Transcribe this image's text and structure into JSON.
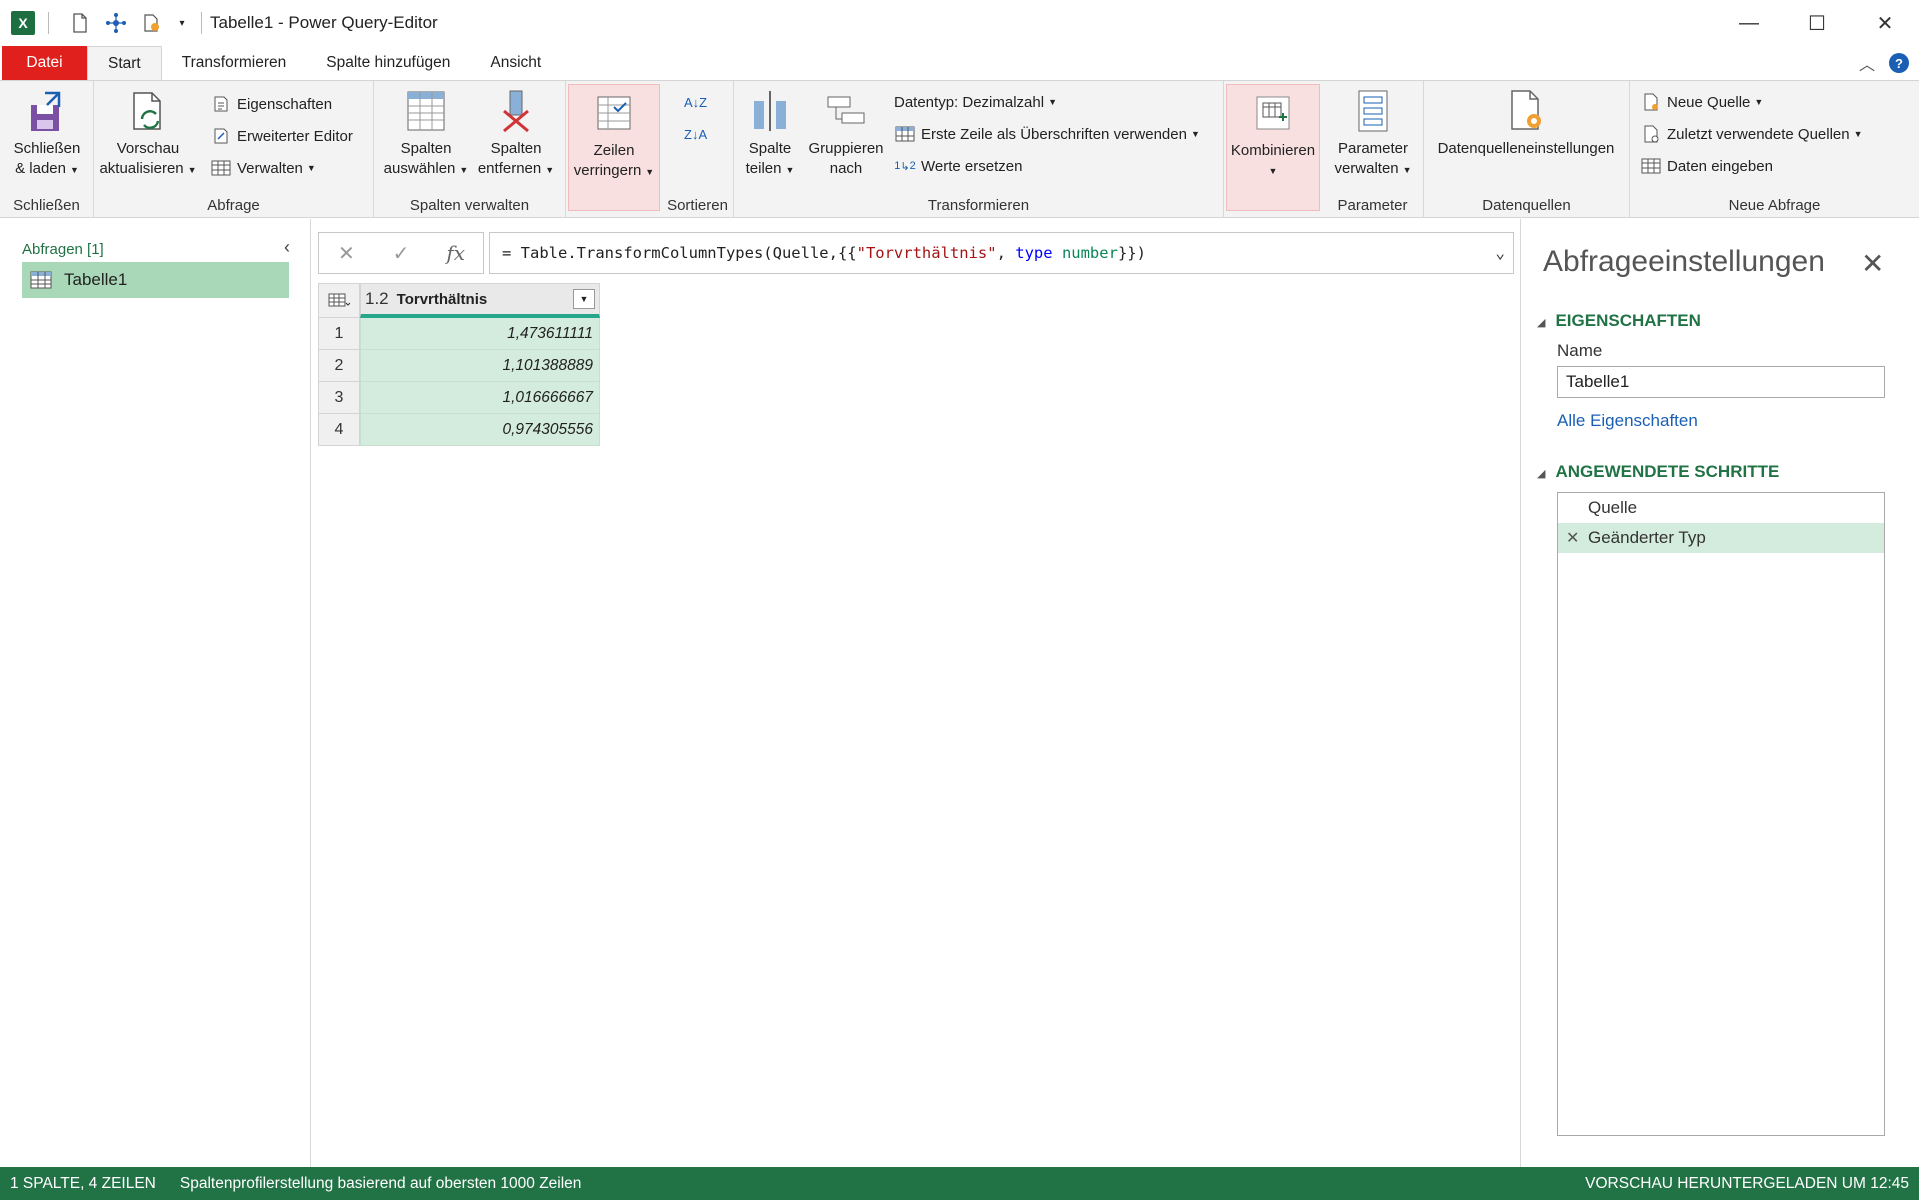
{
  "window": {
    "title": "Tabelle1 - Power Query-Editor",
    "minimize": "—",
    "maximize": "☐",
    "close": "✕"
  },
  "tabs": [
    "Datei",
    "Start",
    "Transformieren",
    "Spalte hinzufügen",
    "Ansicht"
  ],
  "ribbon": {
    "close": {
      "btn_line1": "Schließen",
      "btn_line2": "& laden",
      "group": "Schließen"
    },
    "query": {
      "refresh_line1": "Vorschau",
      "refresh_line2": "aktualisieren",
      "properties": "Eigenschaften",
      "advanced_editor": "Erweiterter Editor",
      "manage": "Verwalten",
      "group": "Abfrage"
    },
    "columns": {
      "choose_line1": "Spalten",
      "choose_line2": "auswählen",
      "remove_line1": "Spalten",
      "remove_line2": "entfernen",
      "group": "Spalten verwalten"
    },
    "rows": {
      "reduce_line1": "Zeilen",
      "reduce_line2": "verringern"
    },
    "sort": {
      "group": "Sortieren",
      "az": "A↓Z",
      "za": "Z↓A"
    },
    "transform": {
      "split_line1": "Spalte",
      "split_line2": "teilen",
      "group_line1": "Gruppieren",
      "group_line2": "nach",
      "datatype": "Datentyp: Dezimalzahl",
      "first_row_header": "Erste Zeile als Überschriften verwenden",
      "replace_values": "Werte ersetzen",
      "replace_prefix": "1",
      "replace_suffix": "2",
      "group": "Transformieren"
    },
    "combine": {
      "label": "Kombinieren"
    },
    "parameters": {
      "manage_line1": "Parameter",
      "manage_line2": "verwalten",
      "group": "Parameter"
    },
    "datasources": {
      "settings": "Datenquelleneinstellungen",
      "group": "Datenquellen"
    },
    "new_query": {
      "new_source": "Neue Quelle",
      "recent_sources": "Zuletzt verwendete Quellen",
      "enter_data": "Daten eingeben",
      "group": "Neue Abfrage"
    }
  },
  "queries_pane": {
    "title": "Abfragen [1]",
    "items": [
      "Tabelle1"
    ]
  },
  "formula_bar": {
    "prefix": "= Table.TransformColumnTypes(Quelle,{{",
    "string": "\"Torvrthältnis\"",
    "sep": ", ",
    "keyword": "type",
    "type_name": "number",
    "suffix": "}})"
  },
  "grid": {
    "column_type": "1.2",
    "column_name": "Torvrthältnis",
    "rows": [
      {
        "num": "1",
        "value": "1,473611111"
      },
      {
        "num": "2",
        "value": "1,101388889"
      },
      {
        "num": "3",
        "value": "1,016666667"
      },
      {
        "num": "4",
        "value": "0,974305556"
      }
    ]
  },
  "settings": {
    "title": "Abfrageeinstellungen",
    "properties_section": "EIGENSCHAFTEN",
    "name_label": "Name",
    "name_value": "Tabelle1",
    "all_properties": "Alle Eigenschaften",
    "steps_section": "ANGEWENDETE SCHRITTE",
    "steps": [
      "Quelle",
      "Geänderter Typ"
    ]
  },
  "status": {
    "left": "1 SPALTE, 4 ZEILEN",
    "middle": "Spaltenprofilerstellung basierend auf obersten 1000 Zeilen",
    "right": "VORSCHAU HERUNTERGELADEN UM 12:45"
  },
  "colors": {
    "accent_green": "#217346",
    "file_tab": "#e0201c",
    "selection": "#a9d8b8"
  }
}
